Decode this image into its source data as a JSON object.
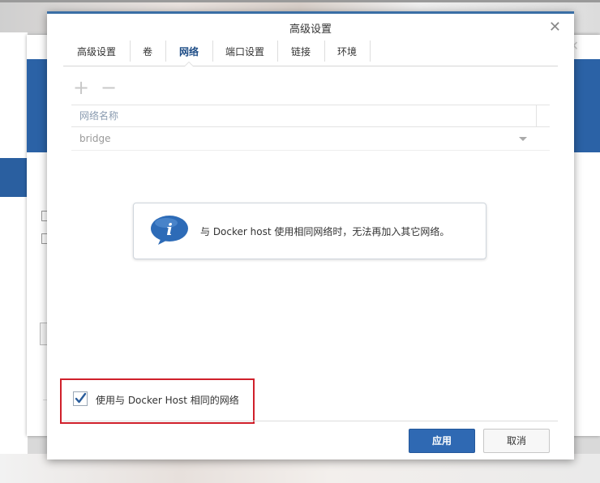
{
  "dialog": {
    "title": "高级设置",
    "close_icon": "close-icon"
  },
  "tabs": [
    {
      "label": "高级设置",
      "active": false
    },
    {
      "label": "卷",
      "active": false
    },
    {
      "label": "网络",
      "active": true
    },
    {
      "label": "端口设置",
      "active": false
    },
    {
      "label": "链接",
      "active": false
    },
    {
      "label": "环境",
      "active": false
    }
  ],
  "toolbar": {
    "add_icon": "plus-icon",
    "remove_icon": "minus-icon"
  },
  "network_table": {
    "column_header": "网络名称",
    "rows": [
      {
        "name": "bridge"
      }
    ]
  },
  "info": {
    "icon": "info-icon",
    "message": "与 Docker host 使用相同网络时，无法再加入其它网络。"
  },
  "host_network_option": {
    "label": "使用与 Docker Host 相同的网络",
    "checked": true
  },
  "buttons": {
    "apply": "应用",
    "cancel": "取消"
  },
  "colors": {
    "accent": "#2f69b3",
    "highlight": "#d0202b"
  }
}
